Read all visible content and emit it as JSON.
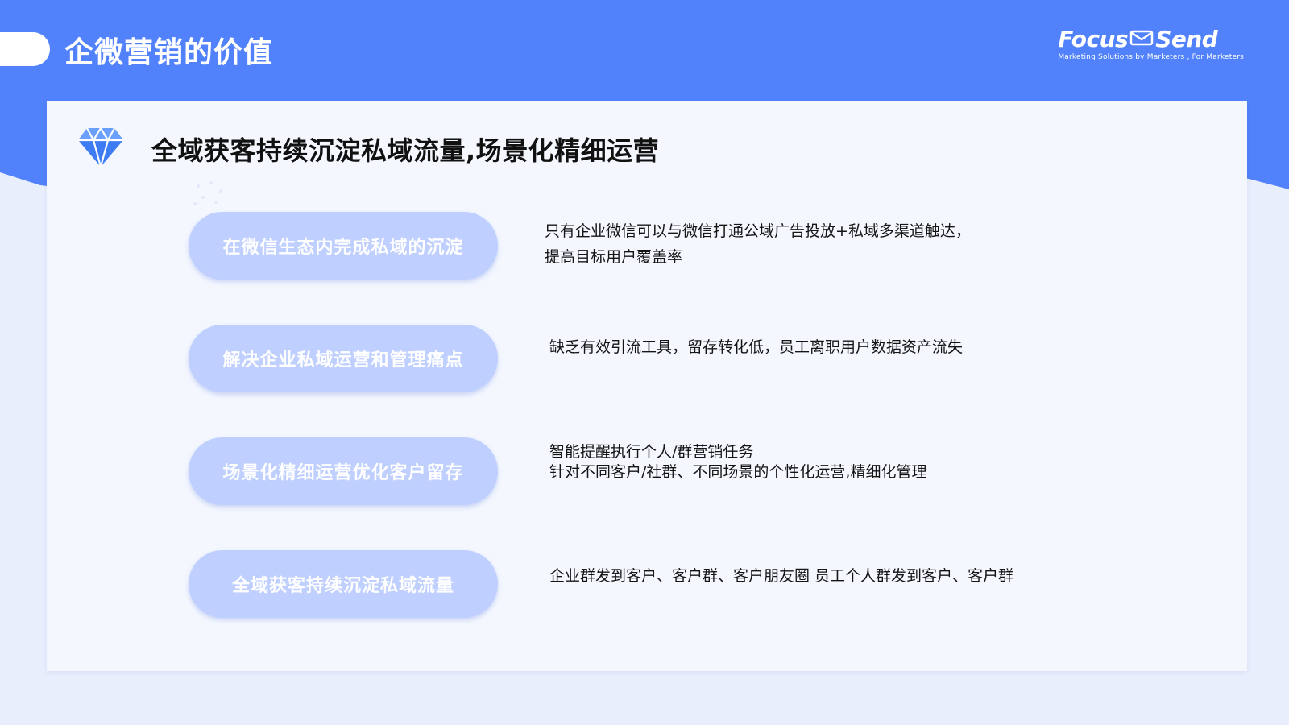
{
  "slide": {
    "title": "企微营销的价值"
  },
  "brand": {
    "name_left": "Focus",
    "name_right": "Send",
    "tagline": "Marketing Solutions by Marketers , For Marketers"
  },
  "card": {
    "title": "全域获客持续沉淀私域流量,场景化精细运营",
    "rows": [
      {
        "label": "在微信生态内完成私域的沉淀",
        "lines": [
          "只有企业微信可以与微信打通公域广告投放+私域多渠道触达，",
          "提高目标用户覆盖率"
        ]
      },
      {
        "label": "解决企业私域运营和管理痛点",
        "lines": [
          "缺乏有效引流工具，留存转化低，员工离职用户数据资产流失"
        ]
      },
      {
        "label": "场景化精细运营优化客户留存",
        "lines": [
          "智能提醒执行个人/群营销任务",
          "针对不同客户/社群、不同场景的个性化运营,精细化管理"
        ]
      },
      {
        "label": "全域获客持续沉淀私域流量",
        "lines": [
          "企业群发到客户、客户群、客户朋友圈 员工个人群发到客户、客户群"
        ]
      }
    ]
  },
  "colors": {
    "header_blue": "#5182fb",
    "pill_fill": "#bfcfff",
    "card_bg": "#f4f7fe",
    "page_bg": "#e9eefc",
    "icon_blue": "#3d7cf2"
  },
  "icons": {
    "title_icon": "diamond-icon",
    "logo_icon": "envelope-icon"
  }
}
